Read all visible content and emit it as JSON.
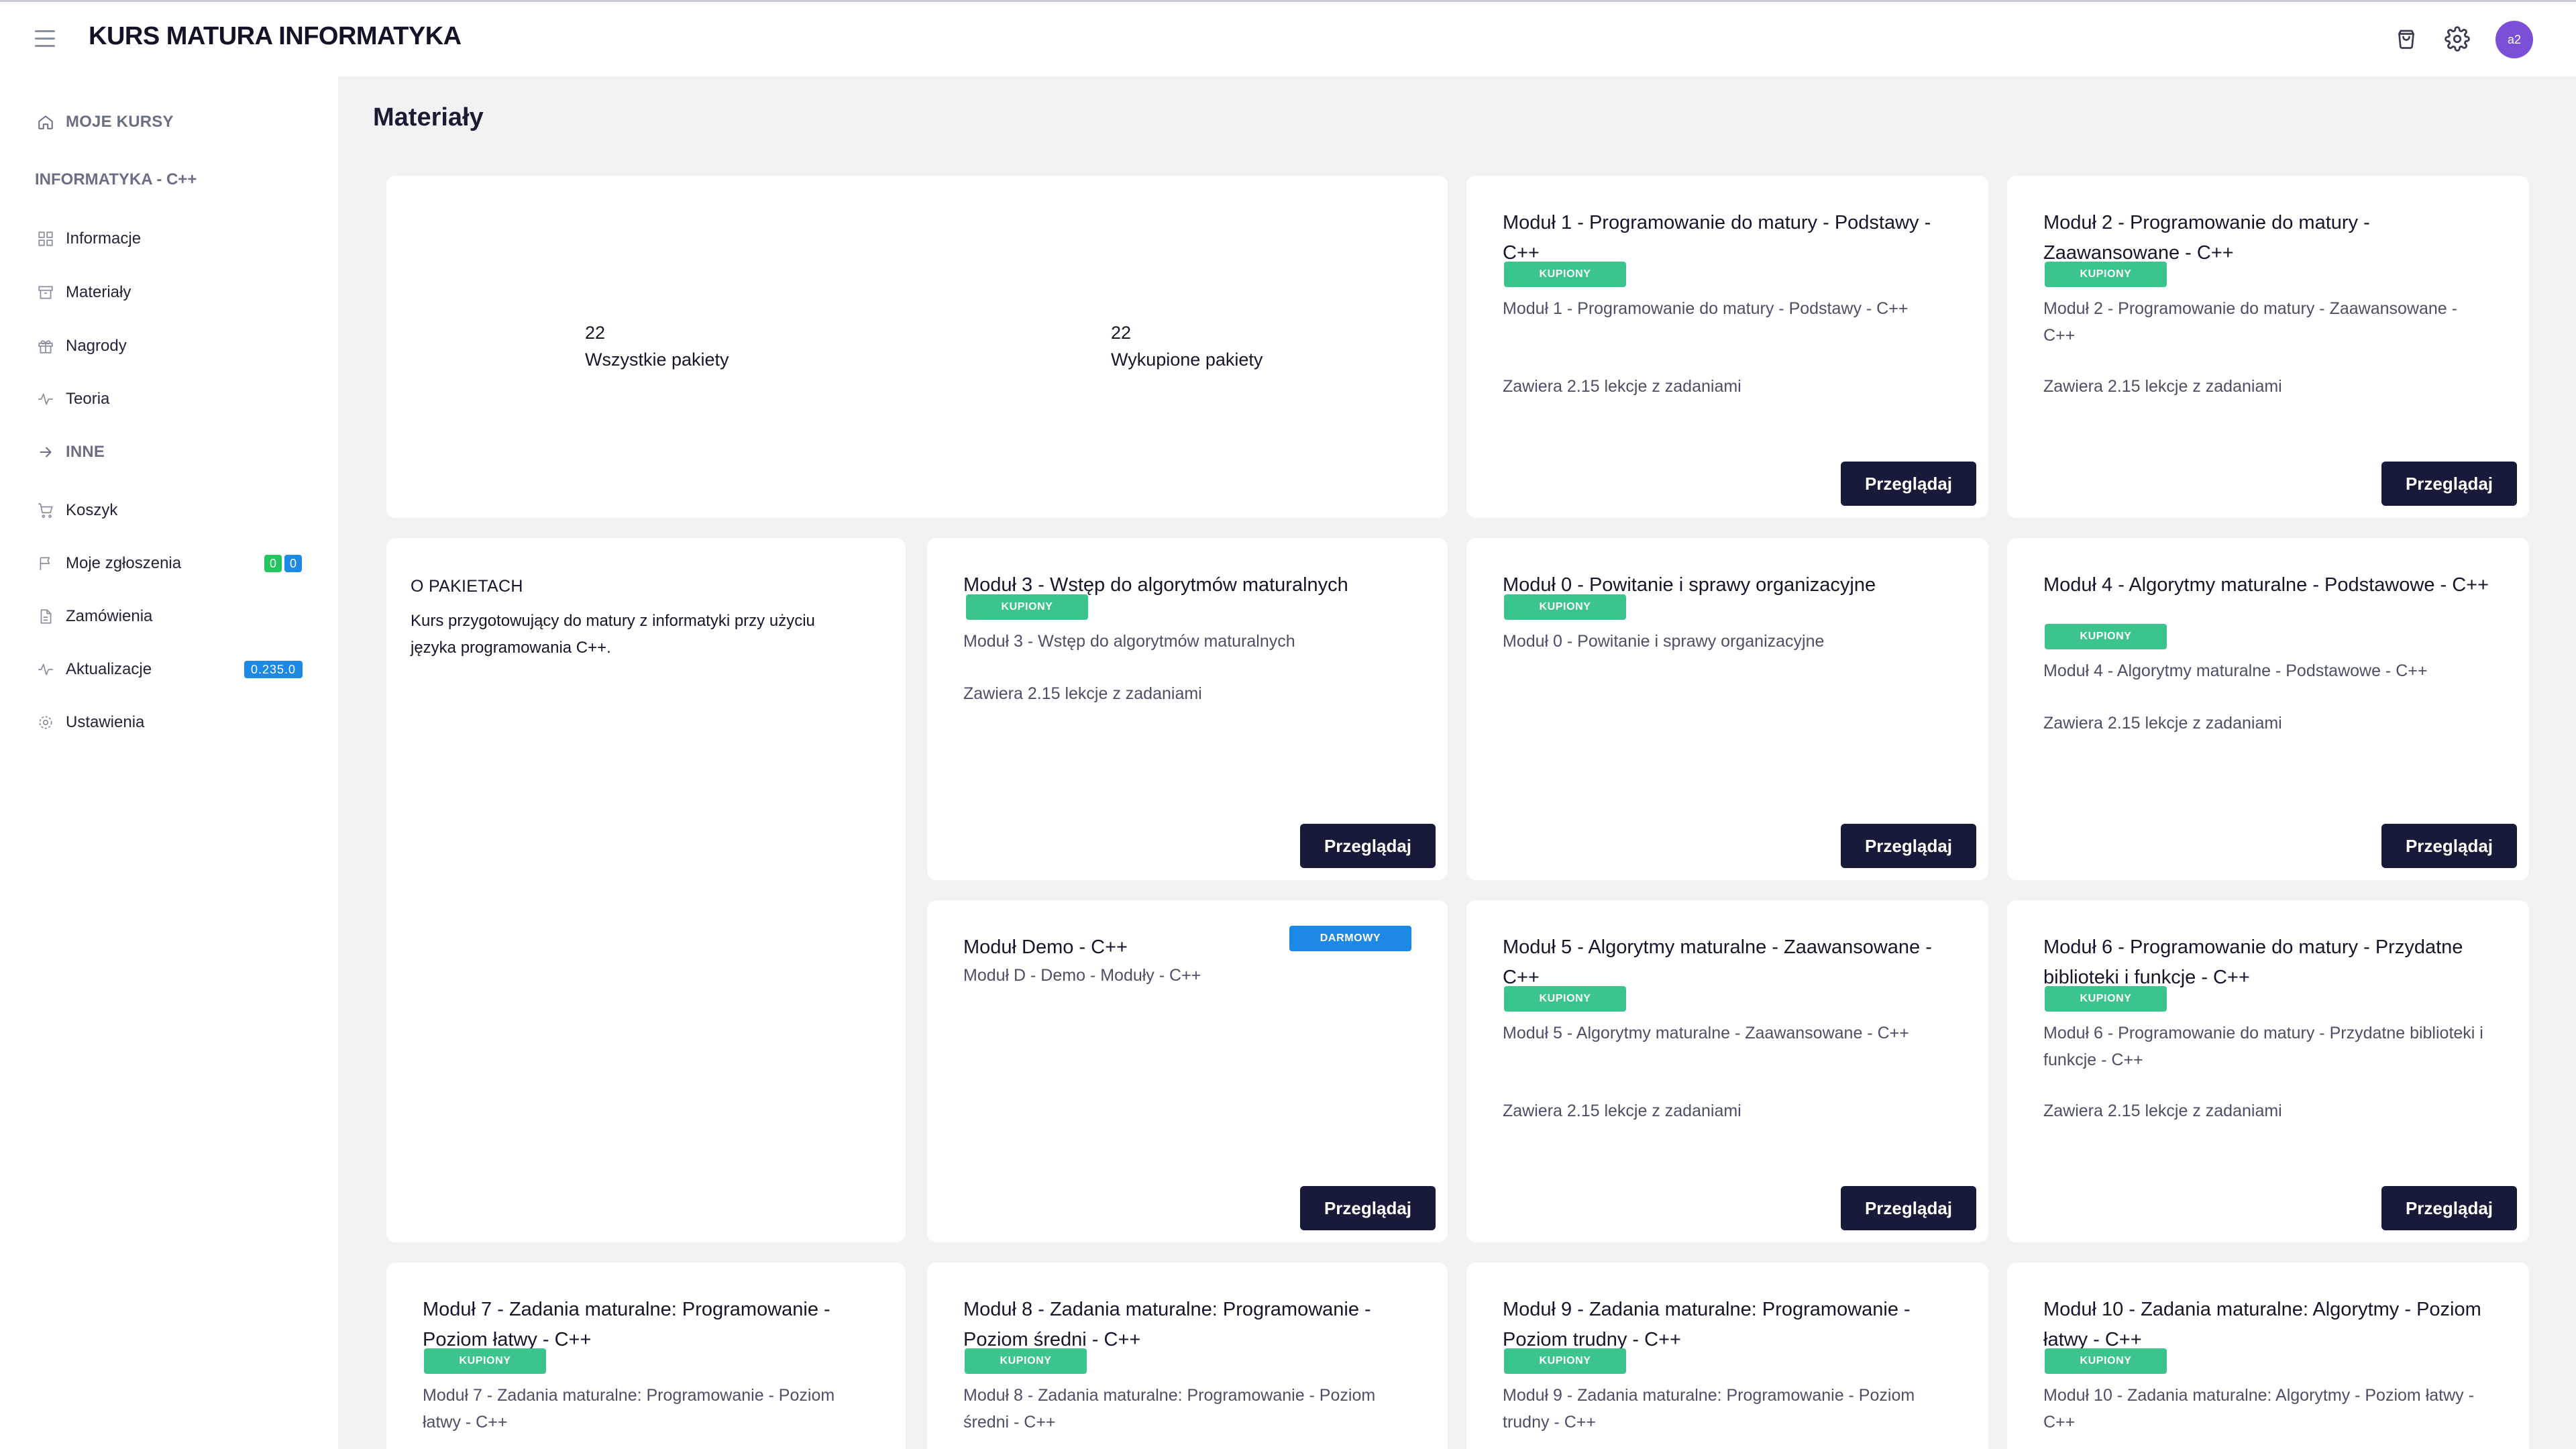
{
  "header": {
    "brand": "KURS MATURA INFORMATYKA",
    "avatar_text": "a2",
    "icons": [
      "menu-icon",
      "cart-icon",
      "settings-icon"
    ]
  },
  "sidebar": {
    "my_courses": "MOJE KURSY",
    "course_section": "INFORMATYKA - C++",
    "items": [
      {
        "label": "Informacje",
        "icon": "grid-icon"
      },
      {
        "label": "Materiały",
        "icon": "archive-icon"
      },
      {
        "label": "Nagrody",
        "icon": "gift-icon"
      },
      {
        "label": "Teoria",
        "icon": "pulse-icon"
      }
    ],
    "other_section": "INNE",
    "other_items": [
      {
        "label": "Koszyk",
        "icon": "cart-icon"
      },
      {
        "label": "Moje zgłoszenia",
        "icon": "flag-icon",
        "badges": [
          "0",
          "0"
        ]
      },
      {
        "label": "Zamówienia",
        "icon": "document-icon"
      },
      {
        "label": "Aktualizacje",
        "icon": "pulse-icon",
        "badge": "0.235.0"
      },
      {
        "label": "Ustawienia",
        "icon": "gear-icon"
      }
    ]
  },
  "main": {
    "title": "Materiały",
    "stats": {
      "all_value": "22",
      "all_label": "Wszystkie pakiety",
      "bought_value": "22",
      "bought_label": "Wykupione pakiety"
    },
    "about": {
      "heading": "O PAKIETACH",
      "text": "Kurs przygotowujący do matury z informatyki przy użyciu języka programowania C++."
    },
    "button_label": "Przeglądaj",
    "lessons_text": "Zawiera 2.15 lekcje z zadaniami",
    "modules": [
      {
        "title": "Moduł 1 - Programowanie do matury - Podstawy - C++",
        "badge": "KUPIONY",
        "desc": "Moduł 1 - Programowanie do matury - Podstawy - C++"
      },
      {
        "title": "Moduł 2 - Programowanie do matury - Zaawansowane - C++",
        "badge": "KUPIONY",
        "desc": "Moduł 2 - Programowanie do matury - Zaawansowane - C++"
      },
      {
        "title": "Moduł 3 - Wstęp do algorytmów maturalnych",
        "badge": "KUPIONY",
        "desc": "Moduł 3 - Wstęp do algorytmów maturalnych"
      },
      {
        "title": "Moduł 0 - Powitanie i sprawy organizacyjne",
        "badge": "KUPIONY",
        "desc": "Moduł 0 - Powitanie i sprawy organizacyjne"
      },
      {
        "title": "Moduł 4 - Algorytmy maturalne - Podstawowe - C++",
        "badge": "KUPIONY",
        "desc": "Moduł 4 - Algorytmy maturalne - Podstawowe - C++"
      },
      {
        "title": "Moduł Demo - C++",
        "badge": "DARMOWY",
        "desc": "Moduł D - Demo - Moduły - C++"
      },
      {
        "title": "Moduł 5 - Algorytmy maturalne - Zaawansowane - C++",
        "badge": "KUPIONY",
        "desc": "Moduł 5 - Algorytmy maturalne - Zaawansowane - C++"
      },
      {
        "title": "Moduł 6 - Programowanie do matury - Przydatne biblioteki i funkcje - C++",
        "badge": "KUPIONY",
        "desc": "Moduł 6 - Programowanie do matury - Przydatne biblioteki i funkcje - C++"
      },
      {
        "title": "Moduł 7 - Zadania maturalne: Programowanie - Poziom łatwy - C++",
        "badge": "KUPIONY",
        "desc": "Moduł 7 - Zadania maturalne: Programowanie - Poziom łatwy - C++"
      },
      {
        "title": "Moduł 8 - Zadania maturalne: Programowanie - Poziom średni - C++",
        "badge": "KUPIONY",
        "desc": "Moduł 8 - Zadania maturalne: Programowanie - Poziom średni - C++"
      },
      {
        "title": "Moduł 9 - Zadania maturalne: Programowanie - Poziom trudny - C++",
        "badge": "KUPIONY",
        "desc": "Moduł 9 - Zadania maturalne: Programowanie - Poziom trudny - C++"
      },
      {
        "title": "Moduł 10 - Zadania maturalne: Algorytmy - Poziom łatwy - C++",
        "badge": "KUPIONY",
        "desc": "Moduł 10 - Zadania maturalne: Algorytmy - Poziom łatwy - C++"
      }
    ]
  },
  "colors": {
    "accent_dark": "#181a39",
    "badge_green": "#3cc48d",
    "badge_blue": "#1e88e5",
    "avatar": "#7b4fd6"
  }
}
